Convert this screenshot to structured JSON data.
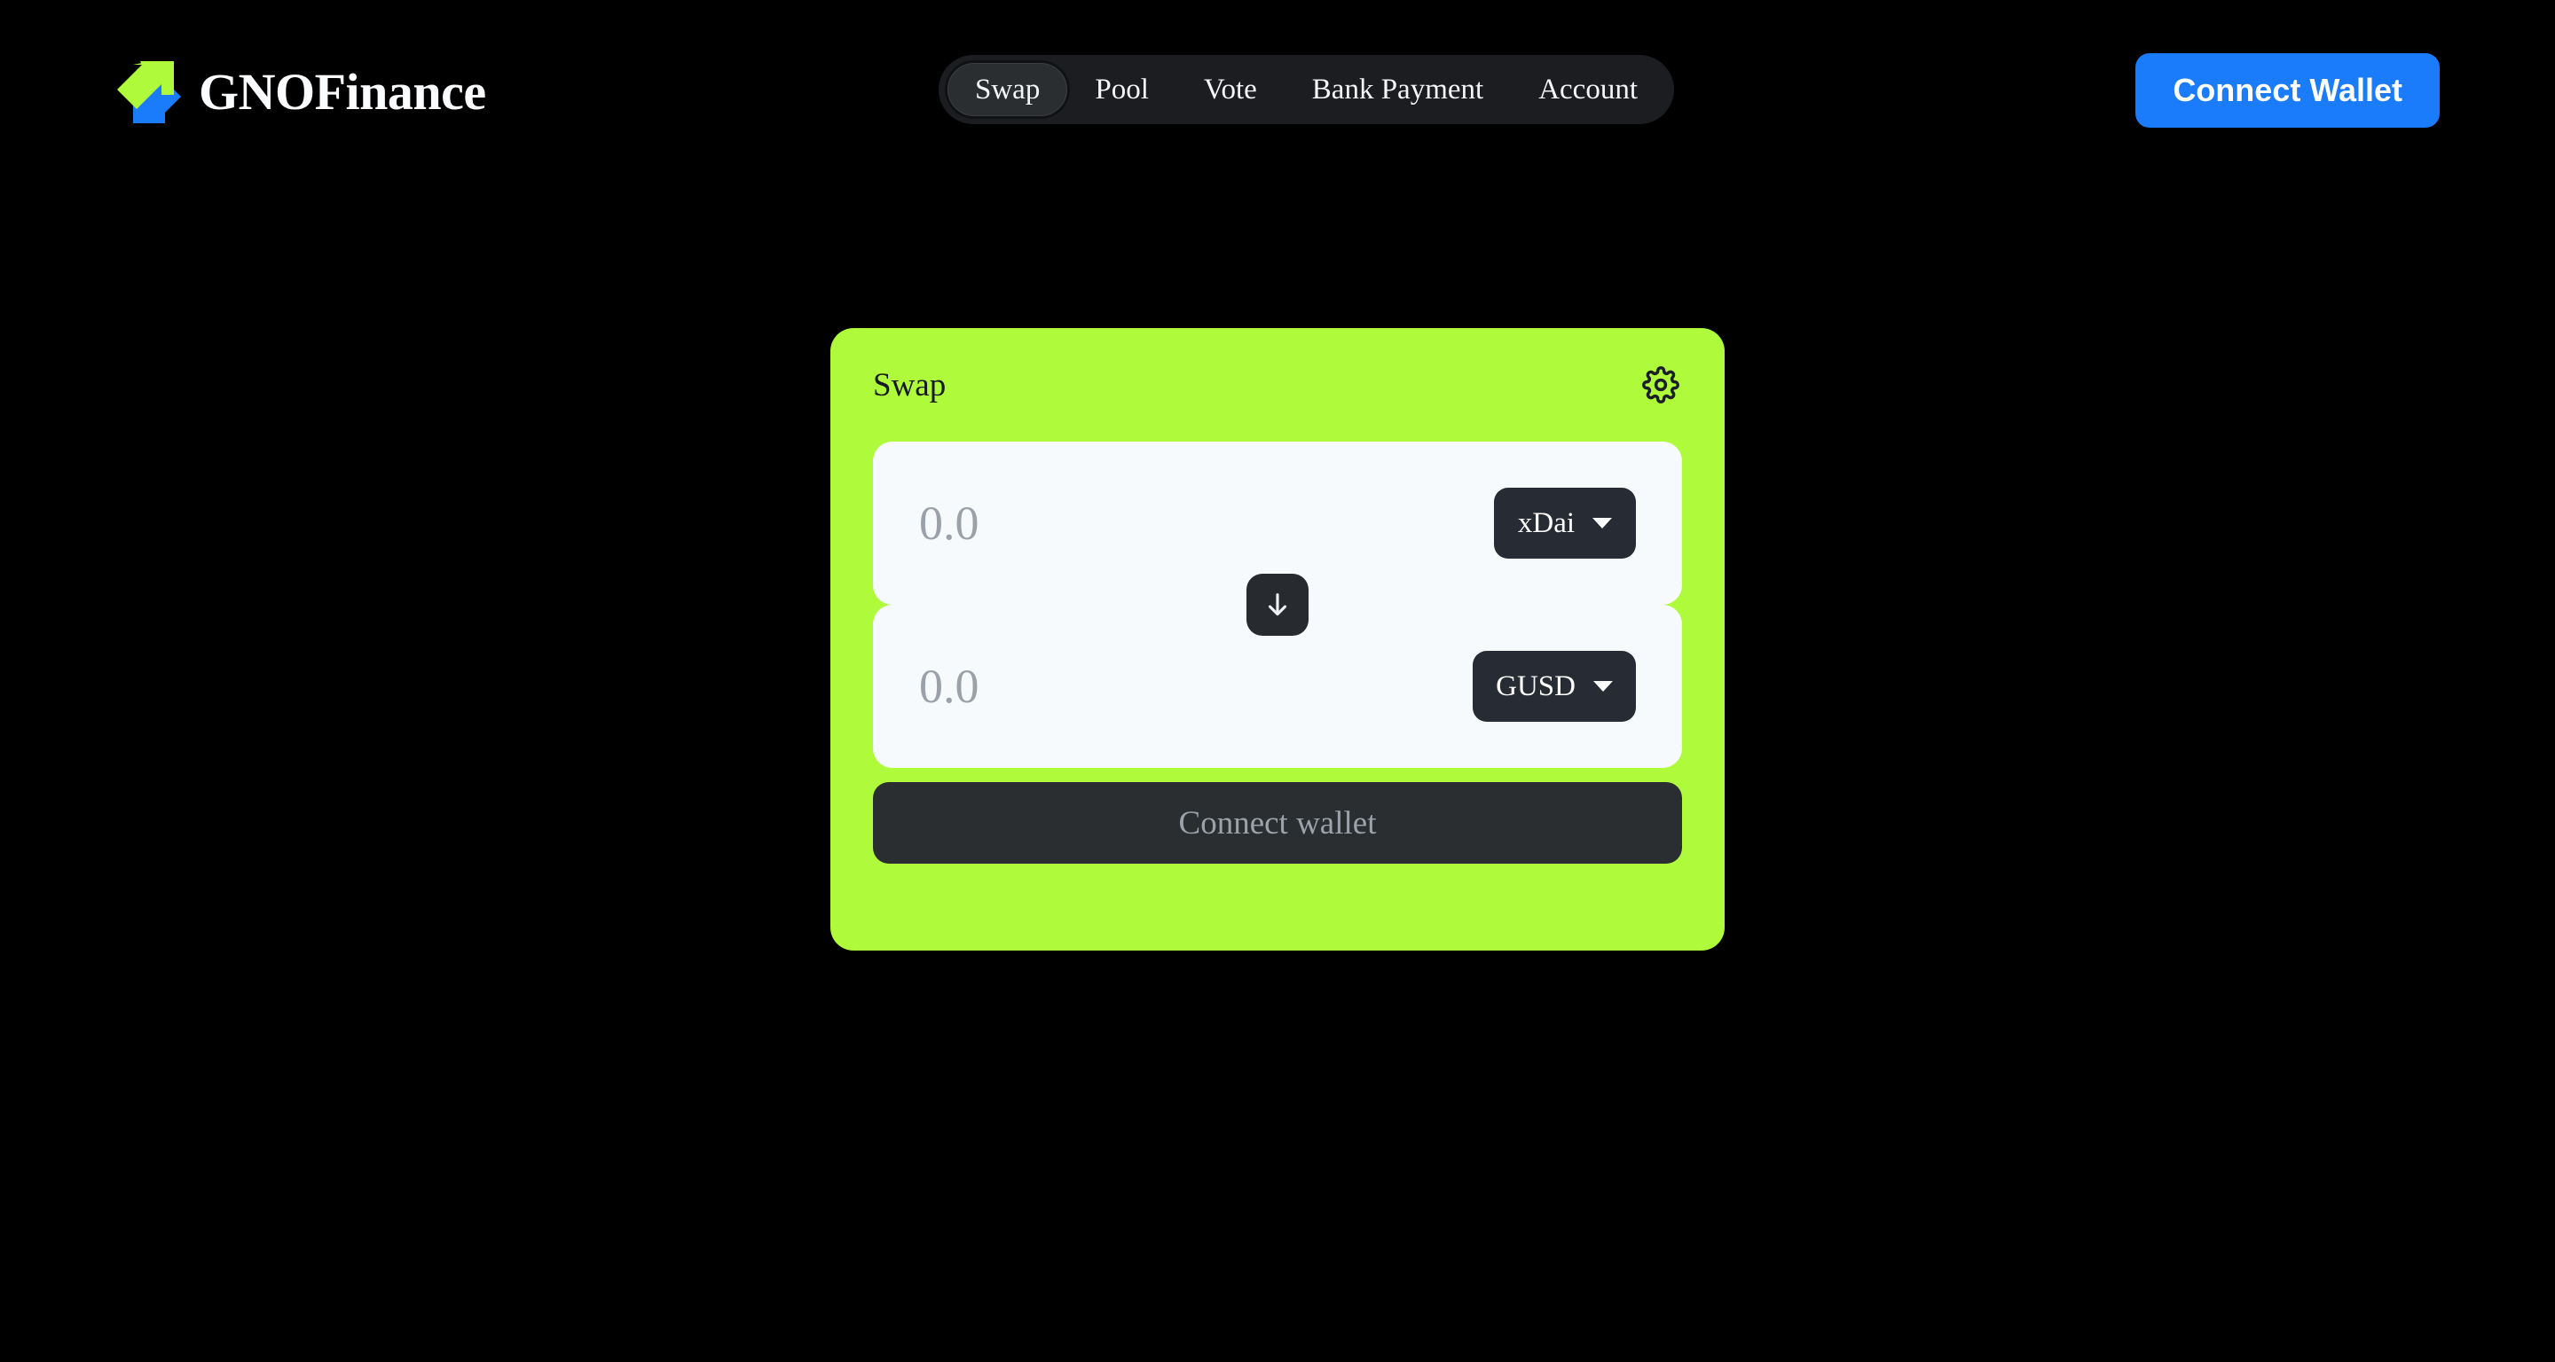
{
  "page": {
    "background_color": "#000000"
  },
  "header": {
    "brand": {
      "name": "GNOFinance",
      "logo_icon": "double-arrow-logo-icon",
      "green_color": "#b0fa3c",
      "blue_color": "#1a7cfa"
    },
    "nav": {
      "items": [
        {
          "label": "Swap",
          "active": true
        },
        {
          "label": "Pool",
          "active": false
        },
        {
          "label": "Vote",
          "active": false
        },
        {
          "label": "Bank Payment",
          "active": false
        },
        {
          "label": "Account",
          "active": false
        }
      ]
    },
    "connect_wallet": {
      "label": "Connect Wallet",
      "color": "#1a7cfa"
    }
  },
  "swap_card": {
    "title": "Swap",
    "accent_color": "#b0fa3c",
    "settings_icon": "gear-icon",
    "swap_direction_icon": "arrow-down-icon",
    "rows": [
      {
        "role": "from",
        "amount_value": "",
        "amount_placeholder": "0.0",
        "token": "xDai",
        "caret_icon": "chevron-down-icon"
      },
      {
        "role": "to",
        "amount_value": "",
        "amount_placeholder": "0.0",
        "token": "GUSD",
        "caret_icon": "chevron-down-icon"
      }
    ],
    "action": {
      "label": "Connect wallet",
      "disabled": true
    }
  }
}
